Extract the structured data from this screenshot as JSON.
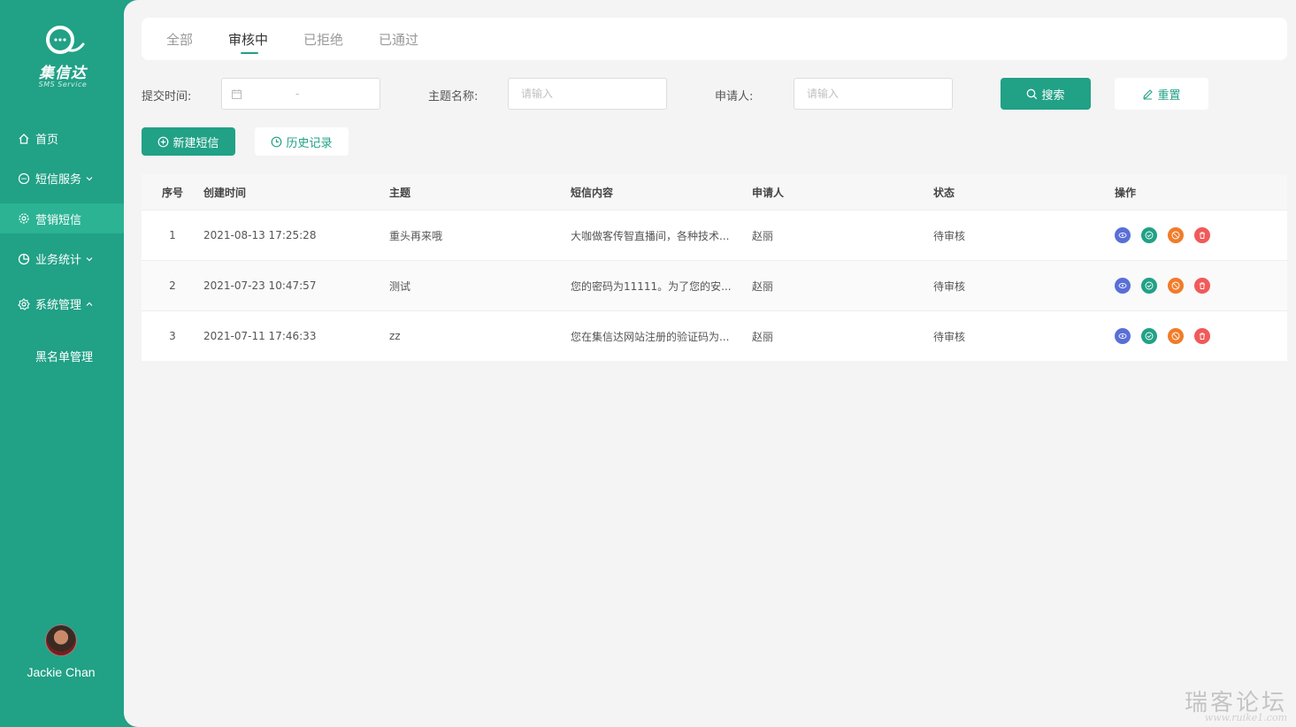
{
  "brand": {
    "name": "集信达",
    "subtitle": "SMS Service"
  },
  "sidebar": {
    "items": [
      {
        "label": "首页",
        "icon": "home-icon"
      },
      {
        "label": "短信服务",
        "icon": "chat-icon",
        "chevron": "down"
      },
      {
        "label": "营销短信",
        "icon": "gear-icon",
        "active": true
      },
      {
        "label": "业务统计",
        "icon": "pie-chart-icon",
        "chevron": "down"
      },
      {
        "label": "系统管理",
        "icon": "settings-icon",
        "chevron": "up"
      },
      {
        "label": "黑名单管理"
      }
    ]
  },
  "user": {
    "name": "Jackie Chan"
  },
  "tabs": [
    "全部",
    "审核中",
    "已拒绝",
    "已通过"
  ],
  "active_tab": "审核中",
  "filters": {
    "date_label": "提交时间:",
    "date_separator": "-",
    "subject_label": "主题名称:",
    "subject_placeholder": "请输入",
    "applicant_label": "申请人:",
    "applicant_placeholder": "请输入",
    "search_button": "搜索",
    "reset_button": "重置"
  },
  "actions": {
    "new_sms": "新建短信",
    "history": "历史记录"
  },
  "table": {
    "columns": [
      "序号",
      "创建时间",
      "主题",
      "短信内容",
      "申请人",
      "状态",
      "操作"
    ],
    "rows": [
      {
        "index": "1",
        "created": "2021-08-13 17:25:28",
        "subject": "重头再来哦",
        "content": "大咖做客传智直播间，各种技术...",
        "applicant": "赵丽",
        "status": "待审核"
      },
      {
        "index": "2",
        "created": "2021-07-23 10:47:57",
        "subject": "测试",
        "content": "您的密码为11111。为了您的安...",
        "applicant": "赵丽",
        "status": "待审核"
      },
      {
        "index": "3",
        "created": "2021-07-11 17:46:33",
        "subject": "zz",
        "content": "您在集信达网站注册的验证码为...",
        "applicant": "赵丽",
        "status": "待审核"
      }
    ],
    "op_colors": {
      "view": "#5a6fd6",
      "approve": "#21a186",
      "reject": "#f07c2a",
      "delete": "#f05a5a"
    }
  },
  "watermark": {
    "main": "瑞客论坛",
    "sub": "www.ruike1.com"
  },
  "colors": {
    "primary": "#21a186",
    "active_nav": "#2bb394"
  }
}
